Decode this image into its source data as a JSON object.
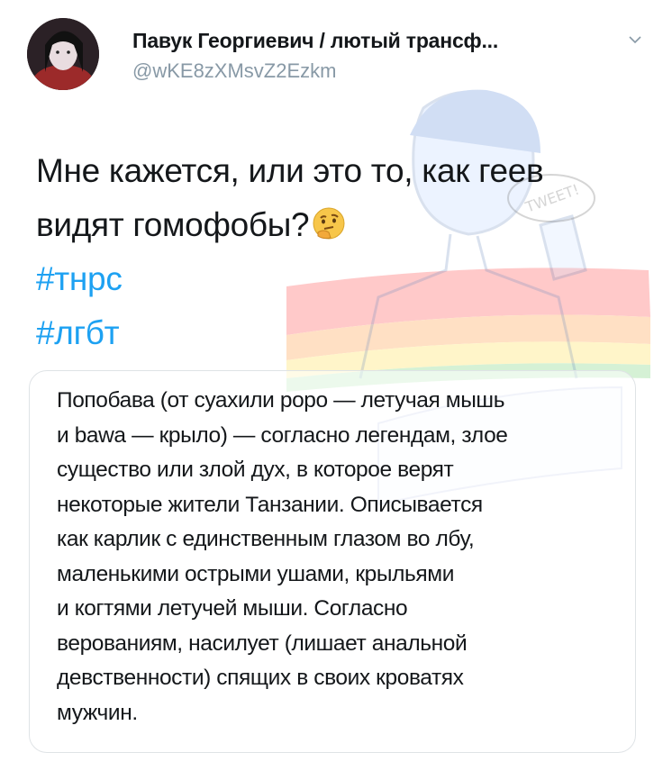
{
  "tweet": {
    "author_name": "Павук Георгиевич / лютый трансф...",
    "author_handle": "@wKE8zXMsvZ2Ezkm",
    "text_lines": [
      "Мне кажется, или это то, как геев",
      "видят гомофобы?"
    ],
    "emoji": "thinking-face",
    "hashtags": [
      "#тнрс",
      "#лгбт"
    ]
  },
  "card": {
    "lines": [
      "Попобава (от суахили popo — летучая мышь",
      "и bawa — крыло) — согласно легендам, злое",
      "существо или злой дух, в которое верят",
      "некоторые жители Танзании. Описывается",
      "как карлик с единственным глазом во лбу,",
      "маленькими острыми ушами, крыльями",
      "и когтями летучей мыши. Согласно",
      "верованиям, насилует (лишает анальной",
      "девственности) спящих в своих кроватях",
      "мужчин."
    ]
  },
  "colors": {
    "text": "#14171a",
    "secondary": "#8899a6",
    "accent": "#1da1f2",
    "border": "#dfe3e6"
  }
}
